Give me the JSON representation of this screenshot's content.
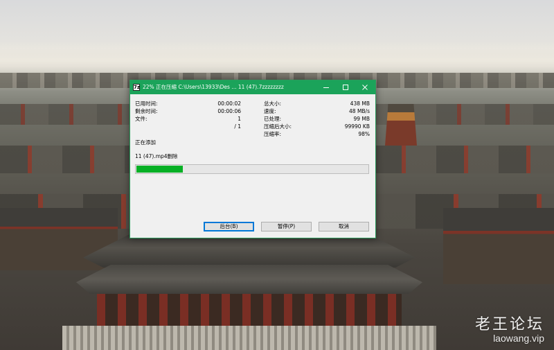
{
  "window": {
    "title": "22% 正在压缩 C:\\Users\\13933\\Des ... 11 (47).7zzzzzzzz",
    "icon_text": "7z",
    "accent_color": "#1ba35a",
    "controls": {
      "minimize": "minimize-icon",
      "maximize": "maximize-icon",
      "close": "close-icon"
    }
  },
  "stats_left": [
    {
      "label": "已用时间:",
      "value": "00:00:02"
    },
    {
      "label": "剩余时间:",
      "value": "00:00:06"
    },
    {
      "label": "文件:",
      "value": "1"
    },
    {
      "label": "",
      "value": "/ 1"
    }
  ],
  "stats_right": [
    {
      "label": "总大小:",
      "value": "438 MB"
    },
    {
      "label": "速度:",
      "value": "48 MB/s"
    },
    {
      "label": "已处理:",
      "value": "99 MB"
    },
    {
      "label": "压缩后大小:",
      "value": "99990 KB"
    },
    {
      "label": "压缩率:",
      "value": "98%"
    }
  ],
  "status_text": "正在添加",
  "current_file": "11 (47).mp4删除",
  "progress": {
    "fraction": 0.2,
    "color": "#06b025"
  },
  "buttons": {
    "background": "后台(B)",
    "pause": "暂停(P)",
    "cancel": "取消"
  },
  "watermark": {
    "title": "老王论坛",
    "url": "laowang.vip"
  }
}
